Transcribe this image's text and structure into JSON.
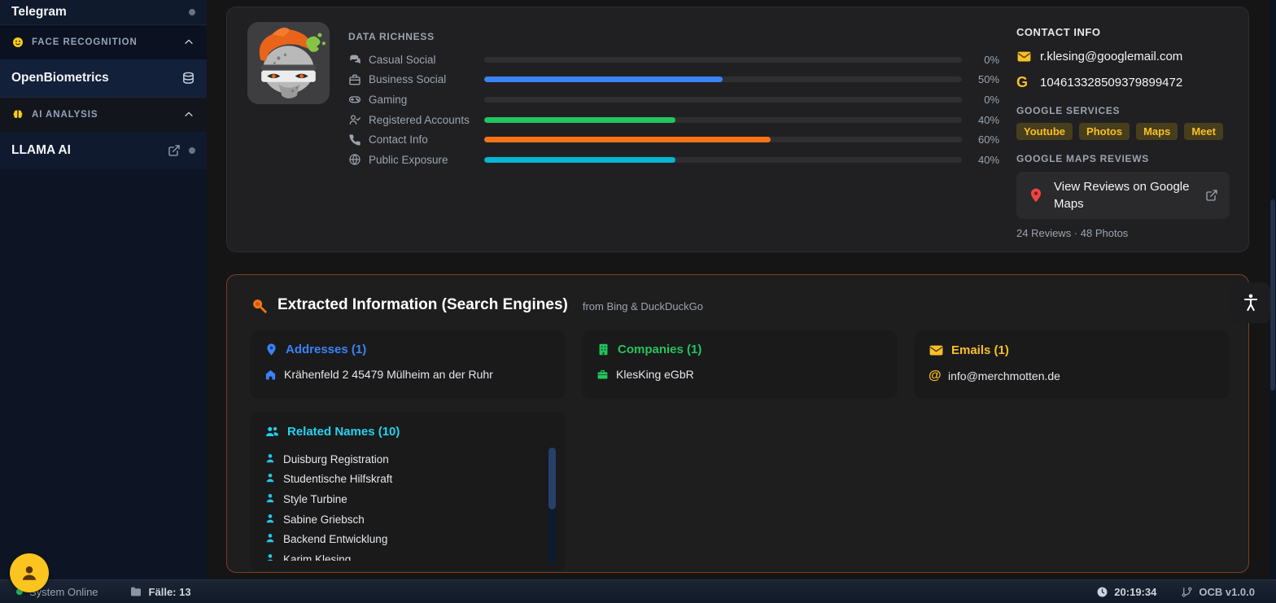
{
  "sidebar": {
    "telegram": "Telegram",
    "face_recognition": "FACE RECOGNITION",
    "openbiometrics": "OpenBiometrics",
    "ai_analysis": "AI ANALYSIS",
    "llama_ai": "LLAMA AI"
  },
  "profile": {
    "data_richness": {
      "title": "DATA RICHNESS",
      "rows": [
        {
          "label": "Casual Social",
          "icon": "chat-bubbles-icon",
          "percent": 0,
          "display": "0%",
          "color": "#2f2f31"
        },
        {
          "label": "Business Social",
          "icon": "briefcase-icon",
          "percent": 50,
          "display": "50%",
          "color": "#3b82f6"
        },
        {
          "label": "Gaming",
          "icon": "gamepad-icon",
          "percent": 0,
          "display": "0%",
          "color": "#2f2f31"
        },
        {
          "label": "Registered Accounts",
          "icon": "user-check-icon",
          "percent": 40,
          "display": "40%",
          "color": "#22c55e"
        },
        {
          "label": "Contact Info",
          "icon": "phone-icon",
          "percent": 60,
          "display": "60%",
          "color": "#f97316"
        },
        {
          "label": "Public Exposure",
          "icon": "globe-icon",
          "percent": 40,
          "display": "40%",
          "color": "#06b6d4"
        }
      ]
    },
    "contact": {
      "title": "CONTACT INFO",
      "email": "r.klesing@googlemail.com",
      "google_id": "104613328509379899472",
      "google_services_label": "GOOGLE SERVICES",
      "services": [
        "Youtube",
        "Photos",
        "Maps",
        "Meet"
      ],
      "maps_reviews_label": "GOOGLE MAPS REVIEWS",
      "reviews_button_label": "View Reviews on Google Maps",
      "reviews_summary": "24 Reviews · 48 Photos"
    }
  },
  "extracted": {
    "title": "Extracted Information (Search Engines)",
    "subtitle": "from Bing & DuckDuckGo",
    "addresses": {
      "title": "Addresses (1)",
      "items": [
        "Krähenfeld 2 45479 Mülheim an der Ruhr"
      ]
    },
    "companies": {
      "title": "Companies (1)",
      "items": [
        "KlesKing eGbR"
      ]
    },
    "emails": {
      "title": "Emails (1)",
      "items": [
        "info@merchmotten.de"
      ]
    },
    "related_names": {
      "title": "Related Names (10)",
      "items": [
        "Duisburg Registration",
        "Studentische Hilfskraft",
        "Style Turbine",
        "Sabine Griebsch",
        "Backend Entwicklung",
        "Karim Klesing"
      ]
    }
  },
  "statusbar": {
    "system": "System Online",
    "cases": "Fälle: 13",
    "time": "20:19:34",
    "version": "OCB v1.0.0"
  },
  "colors": {
    "accent_yellow": "#fbbf24",
    "blue": "#3b82f6",
    "green": "#22c55e",
    "orange": "#f97316",
    "cyan": "#22d3ee",
    "red": "#ef4444"
  }
}
